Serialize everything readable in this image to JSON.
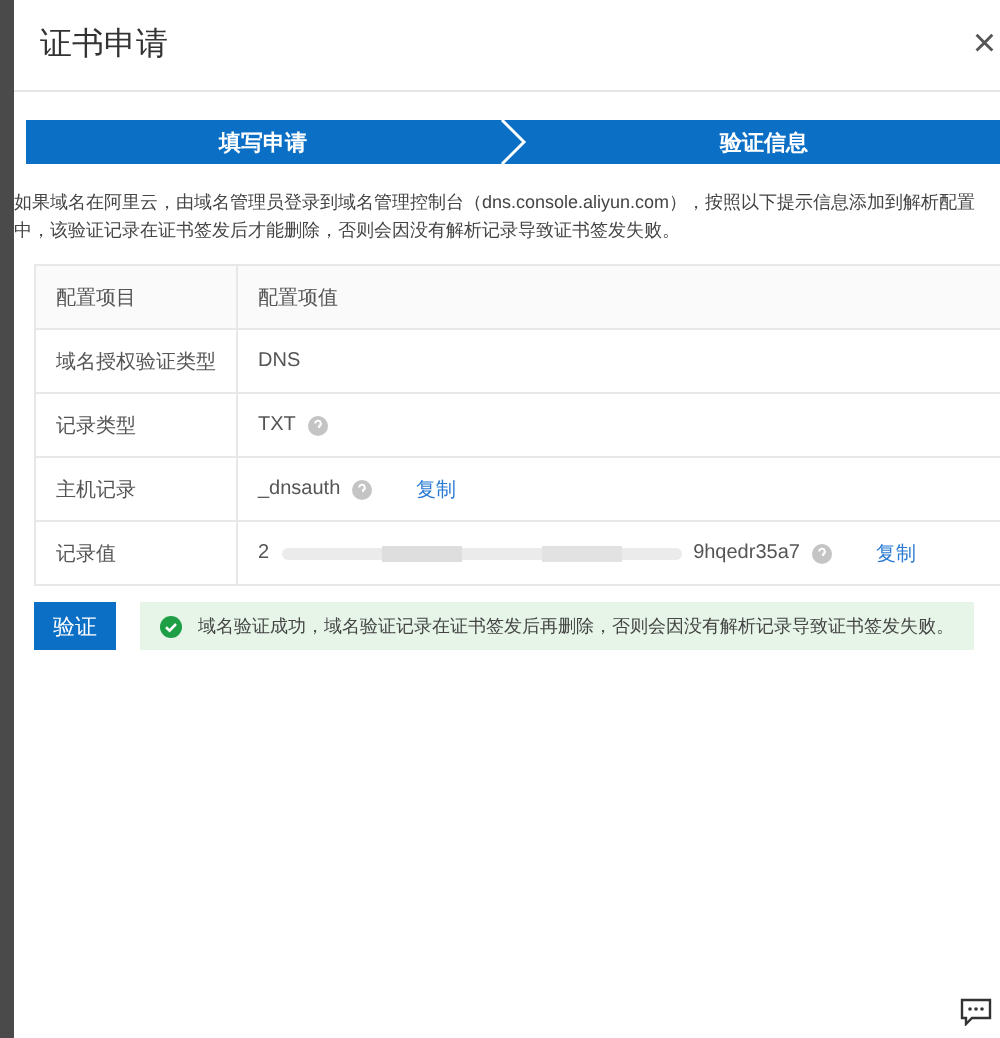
{
  "dialog": {
    "title": "证书申请",
    "close": "×"
  },
  "steps": [
    "填写申请",
    "验证信息"
  ],
  "notice": "如果域名在阿里云，由域名管理员登录到域名管理控制台（dns.console.aliyun.com），按照以下提示信息添加到解析配置中，该验证记录在证书签发后才能删除，否则会因没有解析记录导致证书签发失败。",
  "table": {
    "columns": [
      "配置项目",
      "配置项值"
    ],
    "rows": [
      {
        "label": "域名授权验证类型",
        "value": "DNS",
        "kind": "plain"
      },
      {
        "label": "记录类型",
        "value": "TXT",
        "kind": "help"
      },
      {
        "label": "主机记录",
        "value": "_dnsauth",
        "kind": "help",
        "copy": "复制"
      },
      {
        "label": "记录值",
        "value": "2",
        "value_end": "9hqedr35a7",
        "kind": "masked",
        "copy": "复制"
      }
    ]
  },
  "verify_button": "验证",
  "success_message": "域名验证成功，域名验证记录在证书签发后再删除，否则会因没有解析记录导致证书签发失败。"
}
